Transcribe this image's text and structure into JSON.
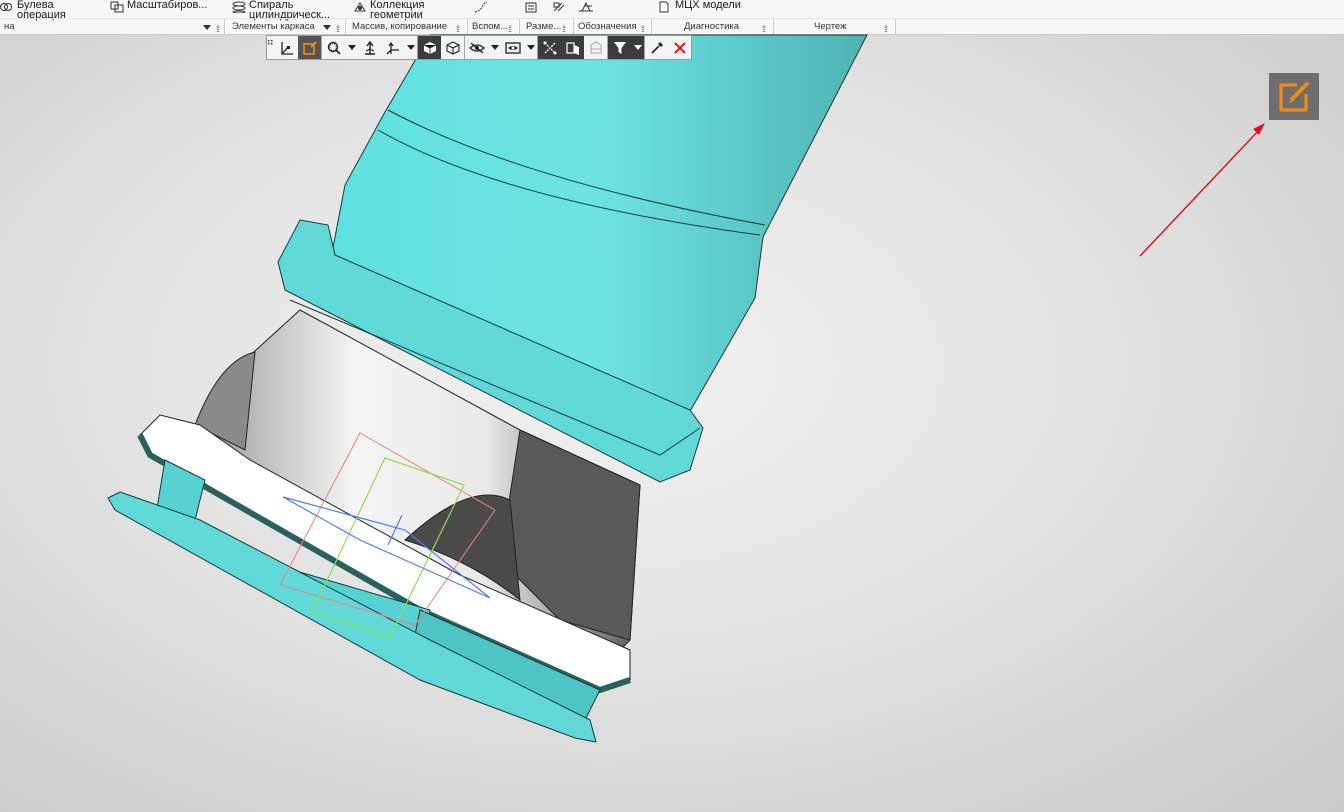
{
  "ribbon": {
    "buttons": [
      {
        "label": "Булева\nоперация",
        "icon": "boolean-icon"
      },
      {
        "label": "Масштабиров...",
        "icon": "scale-icon"
      },
      {
        "label": "Спираль\nцилиндрическ...",
        "icon": "spiral-icon"
      },
      {
        "label": "Коллекция\nгеометрии",
        "icon": "geometry-collection-icon"
      },
      {
        "label": "МЦХ модели",
        "icon": "mass-properties-icon"
      }
    ],
    "groups": [
      {
        "label": "на"
      },
      {
        "label": "Элементы каркаса"
      },
      {
        "label": "Массив, копирование"
      },
      {
        "label": "Вспом..."
      },
      {
        "label": "Разме..."
      },
      {
        "label": "Обозначения"
      },
      {
        "label": "Диагностика"
      },
      {
        "label": "Чертеж"
      }
    ]
  },
  "view_toolbar": {
    "items": [
      "grip-icon",
      "coordinate-system-icon",
      "sketch-edit-icon",
      "zoom-icon",
      "zoom-dropdown",
      "orientation-icon",
      "axes-icon",
      "axes-dropdown",
      "shaded-view-icon",
      "wireframe-view-icon",
      "hide-icon",
      "hide-dropdown",
      "section-view-icon",
      "section-dropdown",
      "constraints-icon",
      "perspective-icon",
      "display-mode-icon",
      "filter-icon",
      "filter-dropdown",
      "eyedropper-icon",
      "close-icon"
    ]
  },
  "floating": {
    "icon": "sketch-edit-icon"
  },
  "colors": {
    "accent": "#f08a1c",
    "model_teal": "#5fd9d9",
    "model_gray": "#8c8c8c",
    "annotation_arrow": "#e01414",
    "close_red": "#e02020"
  }
}
